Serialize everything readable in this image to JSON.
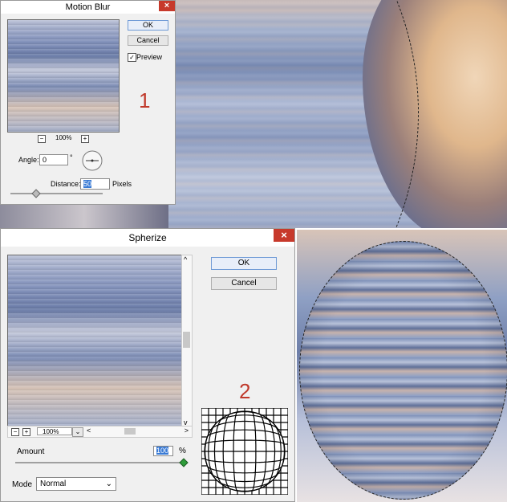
{
  "motion_blur": {
    "title": "Motion Blur",
    "close_icon": "×",
    "ok_label": "OK",
    "cancel_label": "Cancel",
    "preview_label": "Preview",
    "preview_checked": true,
    "zoom_minus": "−",
    "zoom_plus": "+",
    "zoom_value": "100%",
    "angle_label": "Angle:",
    "angle_value": "0",
    "angle_unit": "°",
    "distance_label": "Distance:",
    "distance_value": "50",
    "distance_unit": "Pixels",
    "distance_slider_fraction": 0.25
  },
  "annotation_1": "1",
  "spherize": {
    "title": "Spherize",
    "close_icon": "×",
    "ok_label": "OK",
    "cancel_label": "Cancel",
    "zoom_minus": "−",
    "zoom_plus": "+",
    "zoom_value": "100%",
    "scroll_up": "^",
    "scroll_down": "v",
    "scroll_left": "<",
    "scroll_right": ">",
    "amount_label": "Amount",
    "amount_value": "100",
    "amount_unit": "%",
    "amount_slider_fraction": 1.0,
    "mode_label": "Mode",
    "mode_value": "Normal"
  },
  "annotation_2": "2",
  "colors": {
    "annotation": "#c0392b",
    "close_button": "#c7392b",
    "dialog_bg": "#f0f0f0",
    "default_button_border": "#6f9ad6"
  }
}
